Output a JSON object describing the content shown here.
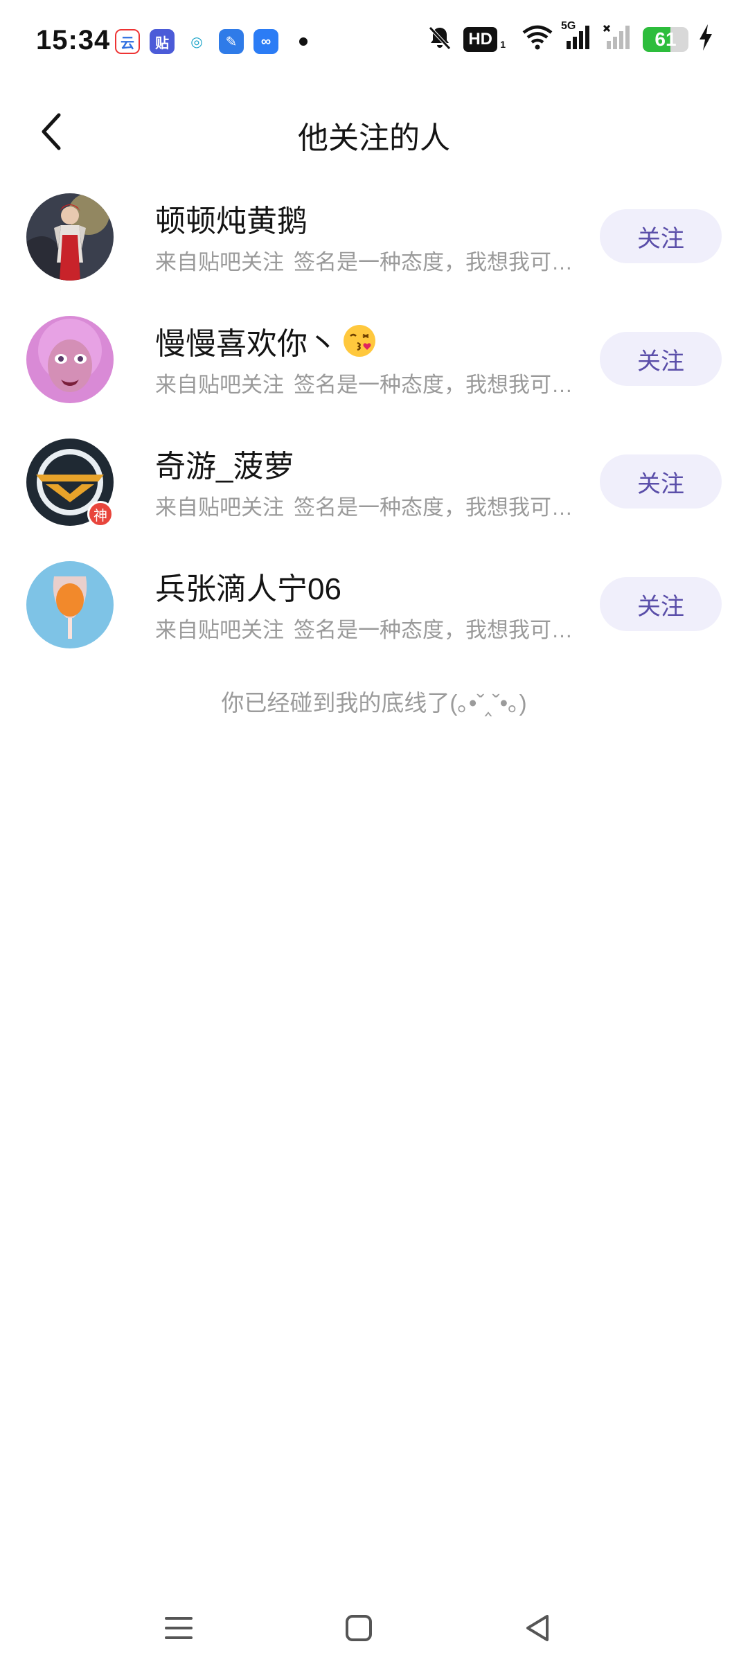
{
  "status_bar": {
    "time": "15:34",
    "notification_icons": [
      {
        "name": "cloud-app-icon",
        "glyph": "云",
        "color": "#2f6fe0"
      },
      {
        "name": "tieba-app-icon",
        "glyph": "贴",
        "color": "#4b5bd8"
      },
      {
        "name": "china-mobile-icon",
        "glyph": "◎",
        "color": "#19a3c8"
      },
      {
        "name": "feather-app-icon",
        "glyph": "✎",
        "color": "#2f7be8"
      },
      {
        "name": "infinity-app-icon",
        "glyph": "∞",
        "color": "#2b7cf5"
      }
    ],
    "hd_label": "HD",
    "hd_sub": "1",
    "signal_label": "5G",
    "battery_percent": "61",
    "battery_level": 0.61,
    "battery_color": "#2dbd3c"
  },
  "header": {
    "title": "他关注的人"
  },
  "users": [
    {
      "name": "顿顿炖黄鹅",
      "source": "来自贴吧关注",
      "signature": "签名是一种态度，我想我可以...",
      "follow_label": "关注",
      "has_emoji": false,
      "has_badge": false
    },
    {
      "name": "慢慢喜欢你丶",
      "source": "来自贴吧关注",
      "signature": "签名是一种态度，我想我可以...",
      "follow_label": "关注",
      "has_emoji": true,
      "has_badge": false
    },
    {
      "name": "奇游_菠萝",
      "source": "来自贴吧关注",
      "signature": "签名是一种态度，我想我可以...",
      "follow_label": "关注",
      "has_emoji": false,
      "has_badge": true,
      "badge_text": "神"
    },
    {
      "name": "兵张滴人宁06",
      "source": "来自贴吧关注",
      "signature": "签名是一种态度，我想我可以...",
      "follow_label": "关注",
      "has_emoji": false,
      "has_badge": false
    }
  ],
  "footer_note": "你已经碰到我的底线了(｡•ˇ‸ˇ•｡)",
  "colors": {
    "follow_text": "#5a4ea9",
    "follow_bg": "#f0effb",
    "secondary_text": "#9a9a9a"
  }
}
